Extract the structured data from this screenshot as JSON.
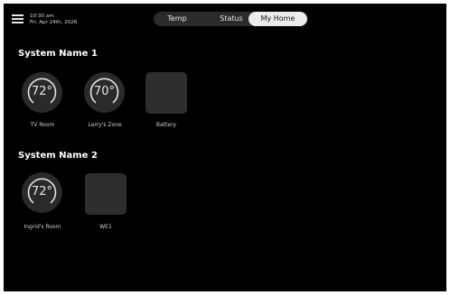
{
  "header": {
    "time": "10:30 am",
    "date": "Fri, Apr 24th, 2026",
    "tabs": [
      {
        "label": "Temp",
        "selected": false
      },
      {
        "label": "Status",
        "selected": false
      },
      {
        "label": "My Home",
        "selected": true
      }
    ]
  },
  "systems": [
    {
      "name": "System Name 1",
      "zones": [
        {
          "type": "dial",
          "temp": "72°",
          "label": "TV Room"
        },
        {
          "type": "dial",
          "temp": "70°",
          "label": "Larry's Zone"
        },
        {
          "type": "device",
          "label": "Battery"
        }
      ]
    },
    {
      "name": "System Name 2",
      "zones": [
        {
          "type": "dial",
          "temp": "72°",
          "label": "Ingrid's Room"
        },
        {
          "type": "device",
          "label": "WE1"
        }
      ]
    }
  ],
  "colors": {
    "background": "#000000",
    "tile": "#2a2a2a",
    "segment_selected": "#ececec"
  }
}
